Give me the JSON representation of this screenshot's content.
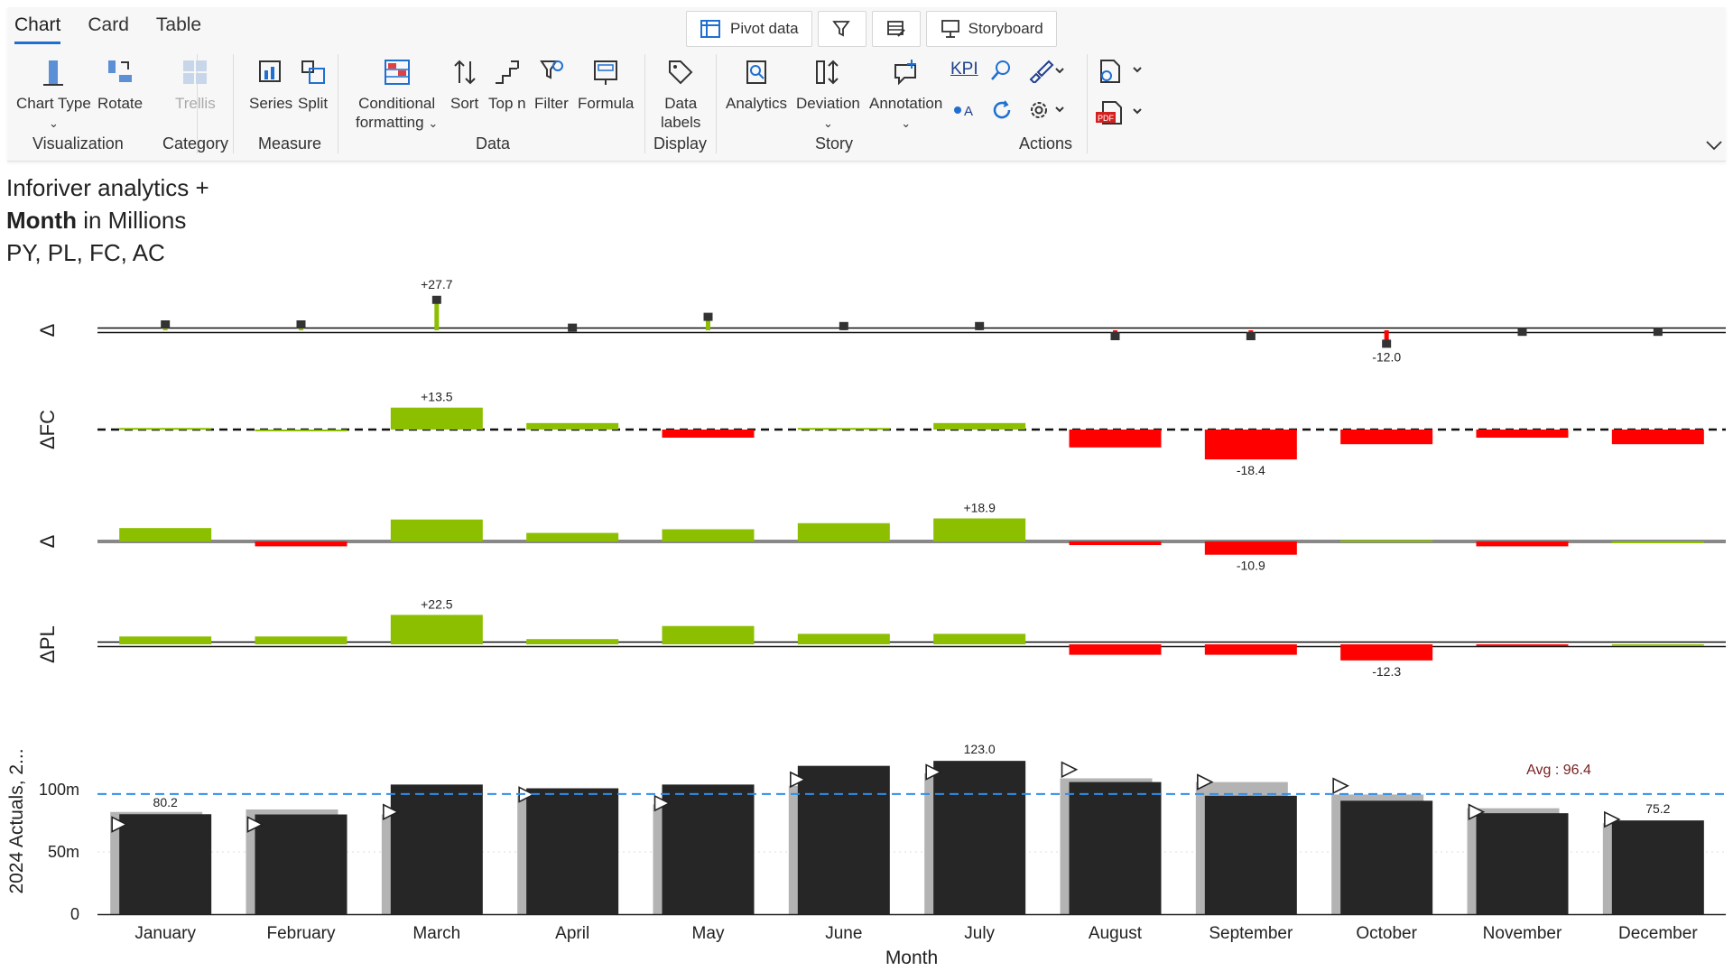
{
  "tabs": [
    "Chart",
    "Card",
    "Table"
  ],
  "top_buttons": {
    "pivot": "Pivot data",
    "storyboard": "Storyboard"
  },
  "ribbon": {
    "chart_type": "Chart Type",
    "rotate": "Rotate",
    "trellis": "Trellis",
    "series": "Series",
    "split": "Split",
    "cond_fmt_1": "Conditional",
    "cond_fmt_2": "formatting",
    "sort": "Sort",
    "topn": "Top n",
    "filter": "Filter",
    "formula": "Formula",
    "data_labels_1": "Data",
    "data_labels_2": "labels",
    "analytics": "Analytics",
    "deviation": "Deviation",
    "annotation": "Annotation",
    "kpi": "KPI"
  },
  "groups": {
    "visualization": "Visualization",
    "category": "Category",
    "measure": "Measure",
    "data": "Data",
    "display": "Display",
    "story": "Story",
    "actions": "Actions"
  },
  "title": {
    "line1": "Inforiver analytics +",
    "line2_bold": "Month",
    "line2_rest": " in Millions",
    "line3": "PY, PL, FC, AC"
  },
  "colors": {
    "positive": "#8cbf00",
    "negative": "#ff0000",
    "actual": "#262626",
    "previous": "#b3b3b3",
    "avg_line": "#2f8ee8",
    "accent": "#1f6fd1"
  },
  "chart_data": {
    "type": "bar",
    "categories": [
      "January",
      "February",
      "March",
      "April",
      "May",
      "June",
      "July",
      "August",
      "September",
      "October",
      "November",
      "December"
    ],
    "xlabel": "Month",
    "ylabel": "2024 Actuals, 2...",
    "ylim": [
      0,
      130
    ],
    "yticks": [
      0,
      50,
      100
    ],
    "ytick_labels": [
      "0",
      "50m",
      "100m"
    ],
    "avg": {
      "value": 96.4,
      "label": "Avg : 96.4"
    },
    "series": [
      {
        "name": "2024 Actuals",
        "values": [
          80.2,
          80,
          104,
          101,
          104,
          119,
          123.0,
          106,
          95,
          91,
          81,
          75.2
        ]
      },
      {
        "values": [
          82,
          84,
          80,
          95,
          88,
          103,
          113,
          109,
          106,
          96,
          85,
          73
        ]
      }
    ],
    "markers": [
      72,
      72,
      82,
      96,
      89,
      108,
      114,
      116,
      106,
      103,
      82,
      76
    ],
    "value_labels": {
      "January": "80.2",
      "July": "123.0",
      "December": "75.2"
    },
    "panels": [
      {
        "axis_label": "Δ",
        "type": "pin",
        "values": [
          5,
          5,
          27.7,
          2,
          12,
          3.5,
          3.5,
          -5,
          -5,
          -12.0,
          -1,
          -1
        ],
        "label_index": [
          2,
          9
        ],
        "labels": [
          "+27.7",
          "-12.0"
        ]
      },
      {
        "axis_label": "ΔFC",
        "type": "bar",
        "values": [
          1,
          0,
          13.5,
          4,
          -5,
          1,
          4,
          -11,
          -18.4,
          -9,
          -5,
          -9
        ],
        "label_index": [
          2,
          8
        ],
        "labels": [
          "+13.5",
          "-18.4"
        ]
      },
      {
        "axis_label": "Δ",
        "type": "bar",
        "values": [
          11,
          -4,
          18,
          7,
          10,
          15,
          18.9,
          -3,
          -10.9,
          1,
          -4,
          0
        ],
        "label_index": [
          6,
          8
        ],
        "labels": [
          "+18.9",
          "-10.9"
        ]
      },
      {
        "axis_label": "ΔPL",
        "type": "bar",
        "values": [
          6,
          6,
          22.5,
          4,
          14,
          8,
          8,
          -8,
          -8,
          -12.3,
          -1,
          0
        ],
        "label_index": [
          2,
          9
        ],
        "labels": [
          "+22.5",
          "-12.3"
        ]
      }
    ]
  }
}
